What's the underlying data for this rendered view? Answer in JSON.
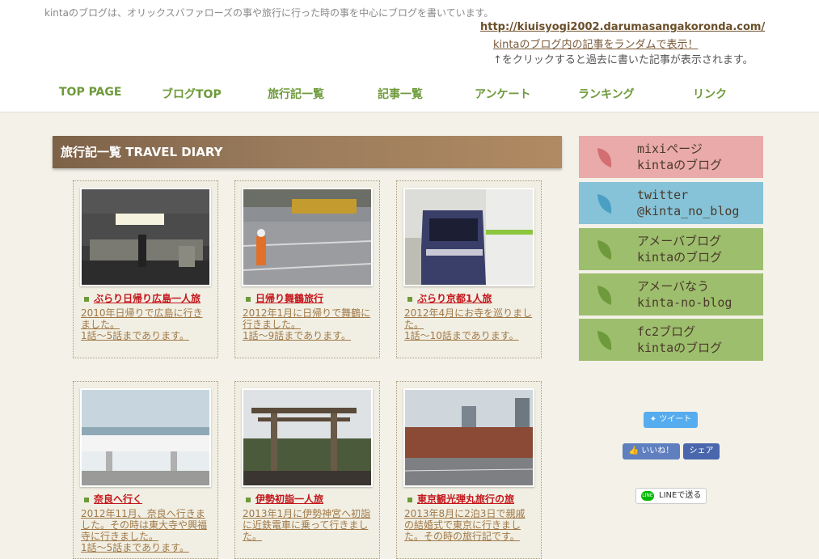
{
  "header": {
    "description": "kintaのブログは、オリックスバファローズの事や旅行に行った時の事を中心にブログを書いています。",
    "url": "http://kiuisyogi2002.darumasangakoronda.com/",
    "random_link": "kintaのブログ内の記事をランダムで表示！",
    "random_note": "↑をクリックすると過去に書いた記事が表示されます。"
  },
  "nav": [
    "TOP PAGE",
    "ブログTOP",
    "旅行記一覧",
    "記事一覧",
    "アンケート",
    "ランキング",
    "リンク"
  ],
  "section_title": "旅行記一覧  TRAVEL DIARY",
  "cards": [
    {
      "title": "ぶらり日帰り広島一人旅",
      "text": "2010年日帰りで広島に行きました。\n1話～5話まであります。"
    },
    {
      "title": "日帰り舞鶴旅行",
      "text": "2012年1月に日帰りで舞鶴に行きました。\n1話～9話まであります。"
    },
    {
      "title": "ぶらり京都1人旅",
      "text": "2012年4月にお寺を巡りました。\n1話～10話まであります。"
    },
    {
      "title": "奈良へ行く",
      "text": "2012年11月、奈良へ行きました。その時は東大寺や興福寺に行きました。\n1話～5話まであります。"
    },
    {
      "title": "伊勢初詣一人旅",
      "text": "2013年1月に伊勢神宮へ初詣に近鉄電車に乗って行きました。"
    },
    {
      "title": "東京観光弾丸旅行の旅",
      "text": "2013年8月に2泊3日で親戚の結婚式で東京に行きました。その時の旅行記です。"
    }
  ],
  "sidebar": [
    {
      "line1": "mixiページ",
      "line2": "kintaのブログ",
      "color": "#e9aaa9"
    },
    {
      "line1": "twitter",
      "line2": "@kinta_no_blog",
      "color": "#86c3d8"
    },
    {
      "line1": "アメーバブログ",
      "line2": "kintaのブログ",
      "color": "#9dbe6d"
    },
    {
      "line1": "アメーバなう",
      "line2": "kinta-no-blog",
      "color": "#9dbe6d"
    },
    {
      "line1": "fc2ブログ",
      "line2": "kintaのブログ",
      "color": "#9dbe6d"
    }
  ],
  "social": {
    "tweet": "ツイート",
    "like": "いいね！",
    "share": "シェア",
    "line": "LINEで送る"
  },
  "icons": {
    "leaf": "leaf-icon",
    "twitter": "twitter-bird-icon",
    "facebook": "thumbs-up-icon",
    "line": "line-logo-icon"
  }
}
